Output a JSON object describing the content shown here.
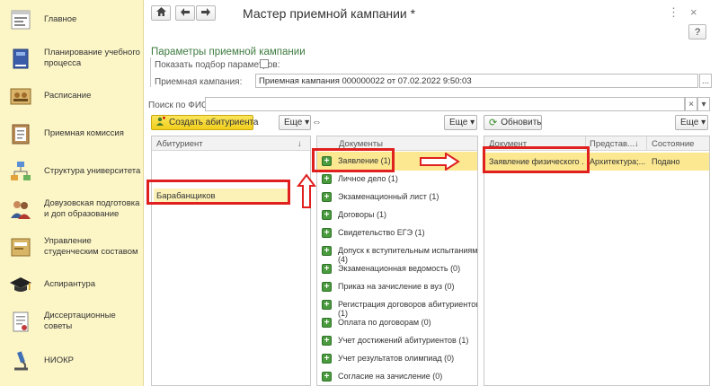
{
  "sidebar": {
    "items": [
      {
        "label": "Главное",
        "icon": "home-icon"
      },
      {
        "label": "Планирование учебного процесса",
        "icon": "book-icon"
      },
      {
        "label": "Расписание",
        "icon": "schedule-icon"
      },
      {
        "label": "Приемная комиссия",
        "icon": "clipboard-icon"
      },
      {
        "label": "Структура университета",
        "icon": "structure-icon"
      },
      {
        "label": "Довузовская подготовка и доп образование",
        "icon": "people-icon"
      },
      {
        "label": "Управление студенческим составом",
        "icon": "folder-icon"
      },
      {
        "label": "Аспирантура",
        "icon": "graduation-cap-icon"
      },
      {
        "label": "Диссертационные советы",
        "icon": "document-icon"
      },
      {
        "label": "НИОКР",
        "icon": "microscope-icon"
      }
    ]
  },
  "window": {
    "title": "Мастер приемной кампании *",
    "help": "?",
    "more_menu": "⋮",
    "close": "×"
  },
  "params": {
    "section_title": "Параметры приемной кампании",
    "show_params_label": "Показать подбор параметров:",
    "campaign_label": "Приемная кампания:",
    "campaign_value": "Приемная кампания 000000022 от 07.02.2022 9:50:03",
    "campaign_open": "...",
    "search_label": "Поиск по ФИО:",
    "search_value": "",
    "search_clear": "×",
    "search_dropdown": "▾"
  },
  "toolbar": {
    "create_applicant": "Создать абитуриента",
    "more": "Еще ▾",
    "more2": "Еще ▾",
    "refresh": "Обновить",
    "more3": "Еще ▾"
  },
  "applicants": {
    "header": "Абитуриент",
    "sort": "↓",
    "selected": "Барабанщиков"
  },
  "documents": {
    "header": "Документы",
    "rows": [
      "Заявление (1)",
      "Личное дело (1)",
      "Экзаменационный лист (1)",
      "Договоры (1)",
      "Свидетельство ЕГЭ (1)",
      "Допуск к вступительным испытаниям (4)",
      "Экзаменационная ведомость (0)",
      "Приказ на зачисление в вуз (0)",
      "Регистрация договоров абитуриентов (1)",
      "Оплата по договорам (0)",
      "Учет достижений абитуриентов (1)",
      "Учет результатов олимпиад (0)",
      "Согласие на зачисление (0)"
    ]
  },
  "detail": {
    "col_document": "Документ",
    "col_represent": "Представ...",
    "sort": "↓",
    "col_state": "Состояние",
    "row": {
      "document": "Заявление физического ...",
      "represent": "Архитектура;...",
      "state": "Подано"
    }
  },
  "colors": {
    "sidebar_bg": "#fcf5c6",
    "accent_yellow": "#f2cf1d",
    "highlight_red": "#e01f1f",
    "section_green": "#3d7b3f"
  }
}
